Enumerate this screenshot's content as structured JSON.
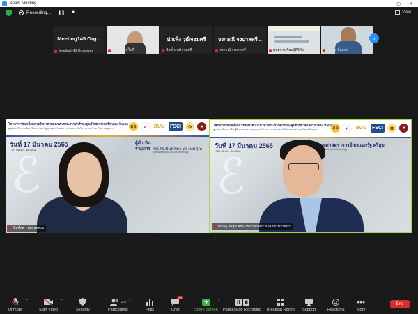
{
  "window": {
    "title": "Zoom Meeting",
    "controls": [
      "—",
      "▢",
      "✕"
    ]
  },
  "toolbar": {
    "recording_label": "Recording...",
    "pause_glyph": "❚❚",
    "stop_glyph": "■",
    "view_label": "View"
  },
  "thumbnails": [
    {
      "center_name": "Meeting145 Org...",
      "footer": "Meeting145 Organizer",
      "type": "name"
    },
    {
      "center_name": "",
      "footer": "อภิรดี รักษ์ใจดี",
      "type": "video"
    },
    {
      "center_name": "นำเพ็ง วุฒิจอมศรี",
      "footer": "นำเพ็ง วุฒิจอมศรี",
      "type": "name"
    },
    {
      "center_name": "จงกลณี จงบาลตรี...",
      "footer": "จงกลณี จงบาลตรี",
      "type": "name"
    },
    {
      "center_name": "",
      "footer": "ศูนย์การเรียนรู้ดิจิทัล",
      "type": "slide"
    },
    {
      "center_name": "",
      "footer": "บรรจง ลิ้มสกุล",
      "type": "video"
    }
  ],
  "slide": {
    "project_title": "โครงการขับเคลื่อนการศึกษาตามแนวทางพระราชดำริของศูนย์วิทยาศาสตร์ภาคตะวันออก",
    "project_sub": "ศูนย์ส่งเสริมการเรียนรู้วิทยาศาสตร์ สู่ชุมชนตะวันออก ร่วมกับ สถาบันวิทยาศาสตร์ มหาวิทยาลัยบูรพา",
    "logos": [
      "ออ",
      "✓",
      "BUU",
      "FSCI",
      "✿",
      "●"
    ],
    "date": "วันที่ 17 มีนาคม 2565",
    "time": "เวลา 08:30 - 16:30 น."
  },
  "tiles": [
    {
      "role": "ผู้ดำเนิน",
      "role2": "รายการ",
      "presenter": "รศ.ดร.พิมพ์ลดา ทองนพคุณ",
      "email": "phimlada@fsci.buu.ac.th/biology",
      "name_tag": "พิมพ์ลดา ทองนพคุณ"
    },
    {
      "role": "ผู้ช่วยศาสตราจารย์ ดร.เอกรัฐ ศรีสุข",
      "role2": "",
      "presenter": "",
      "email": "ekarat@fsci.buu.ac.th/biology",
      "name_tag": "เอกรัฐ ศรีสุข คณะวิทยาศาสตร์ ภาควิชาชีววิทยา"
    }
  ],
  "controls": [
    {
      "label": "Unmute",
      "icon": "mic-muted-icon"
    },
    {
      "label": "Start Video",
      "icon": "video-off-icon"
    },
    {
      "label": "Security",
      "icon": "shield-icon"
    },
    {
      "label": "Participants",
      "icon": "participants-icon",
      "count": "102"
    },
    {
      "label": "Polls",
      "icon": "polls-icon"
    },
    {
      "label": "Chat",
      "icon": "chat-icon",
      "badge": "19"
    },
    {
      "label": "Share Screen",
      "icon": "share-screen-icon"
    },
    {
      "label": "Pause/Stop Recording",
      "icon": "pause-recording-icon"
    },
    {
      "label": "Breakout Rooms",
      "icon": "breakout-rooms-icon"
    },
    {
      "label": "Support",
      "icon": "support-icon"
    },
    {
      "label": "Reactions",
      "icon": "reactions-icon"
    },
    {
      "label": "More",
      "icon": "more-icon"
    }
  ],
  "end_label": "End",
  "colors": {
    "accent": "#2d8cff",
    "end": "#d92c2c",
    "active_speaker": "#a8d84a",
    "share": "#3cb043"
  }
}
